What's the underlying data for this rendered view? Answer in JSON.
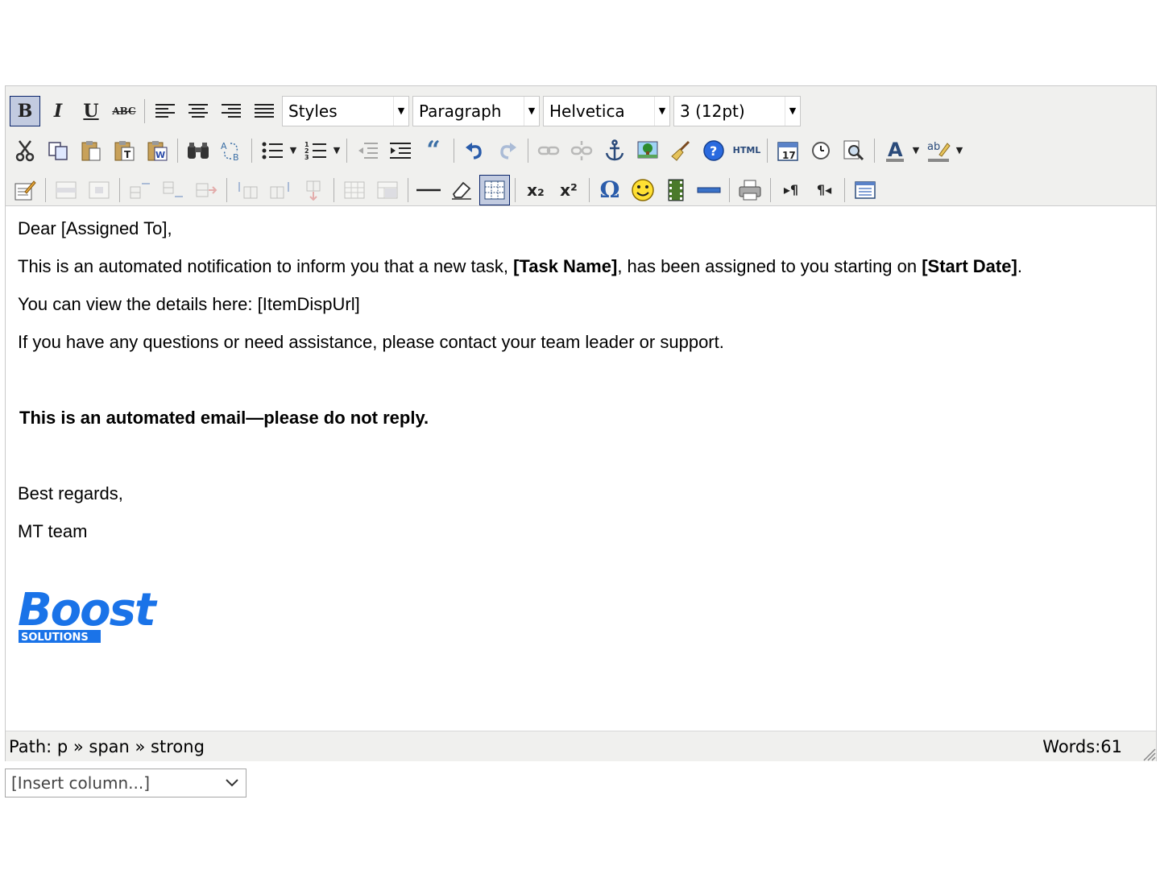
{
  "toolbar": {
    "styles_label": "Styles",
    "format_label": "Paragraph",
    "font_label": "Helvetica",
    "size_label": "3 (12pt)",
    "icons": [
      "bold",
      "italic",
      "underline",
      "strikethrough",
      "align-left",
      "align-center",
      "align-right",
      "align-justify",
      "cut",
      "copy",
      "paste",
      "paste-text",
      "paste-word",
      "find",
      "replace",
      "bullet-list",
      "numbered-list",
      "outdent",
      "indent",
      "blockquote",
      "undo",
      "redo",
      "link",
      "unlink",
      "anchor",
      "image",
      "cleanup",
      "help",
      "html",
      "insert-date",
      "insert-time",
      "preview",
      "text-color",
      "highlight-color",
      "edit-css",
      "row-properties",
      "cell-properties",
      "insert-row-before",
      "insert-row-after",
      "delete-row",
      "insert-col-before",
      "insert-col-after",
      "delete-col",
      "split-cells",
      "merge-cells",
      "horizontal-rule",
      "remove-format",
      "visual-aid",
      "subscript",
      "superscript",
      "special-character",
      "emoticon",
      "media",
      "advanced-hr",
      "print",
      "ltr",
      "rtl",
      "fullscreen"
    ],
    "bold_text": "B",
    "italic_text": "I",
    "underline_text": "U",
    "strike_text": "ABC",
    "html_text": "HTML",
    "sub_text": "x₂",
    "sup_text": "x²",
    "omega_text": "Ω"
  },
  "content": {
    "greeting": "Dear [Assigned To],",
    "line1_pre": "This is an automated notification to inform you that a new task, ",
    "line1_task": "[Task Name]",
    "line1_mid": ", has been assigned to you starting on ",
    "line1_date": "[Start Date]",
    "line1_post": ".",
    "line2": "You can view the details here: [ItemDispUrl]",
    "line3": "If you have any questions or need assistance, please contact your team leader or support.",
    "notice": "This is an automated email—please do not reply.",
    "regards": "Best regards,",
    "signature": "MT team",
    "logo_text": "Boost",
    "logo_subtext": "SOLUTIONS"
  },
  "status": {
    "path": "Path: p » span » strong",
    "words": "Words:61"
  },
  "insert_column": {
    "label": "[Insert column...]"
  },
  "colors": {
    "toolbar_bg": "#f0f0ee",
    "active_btn": "#c2cbe0",
    "logo_blue": "#1a73e8"
  }
}
